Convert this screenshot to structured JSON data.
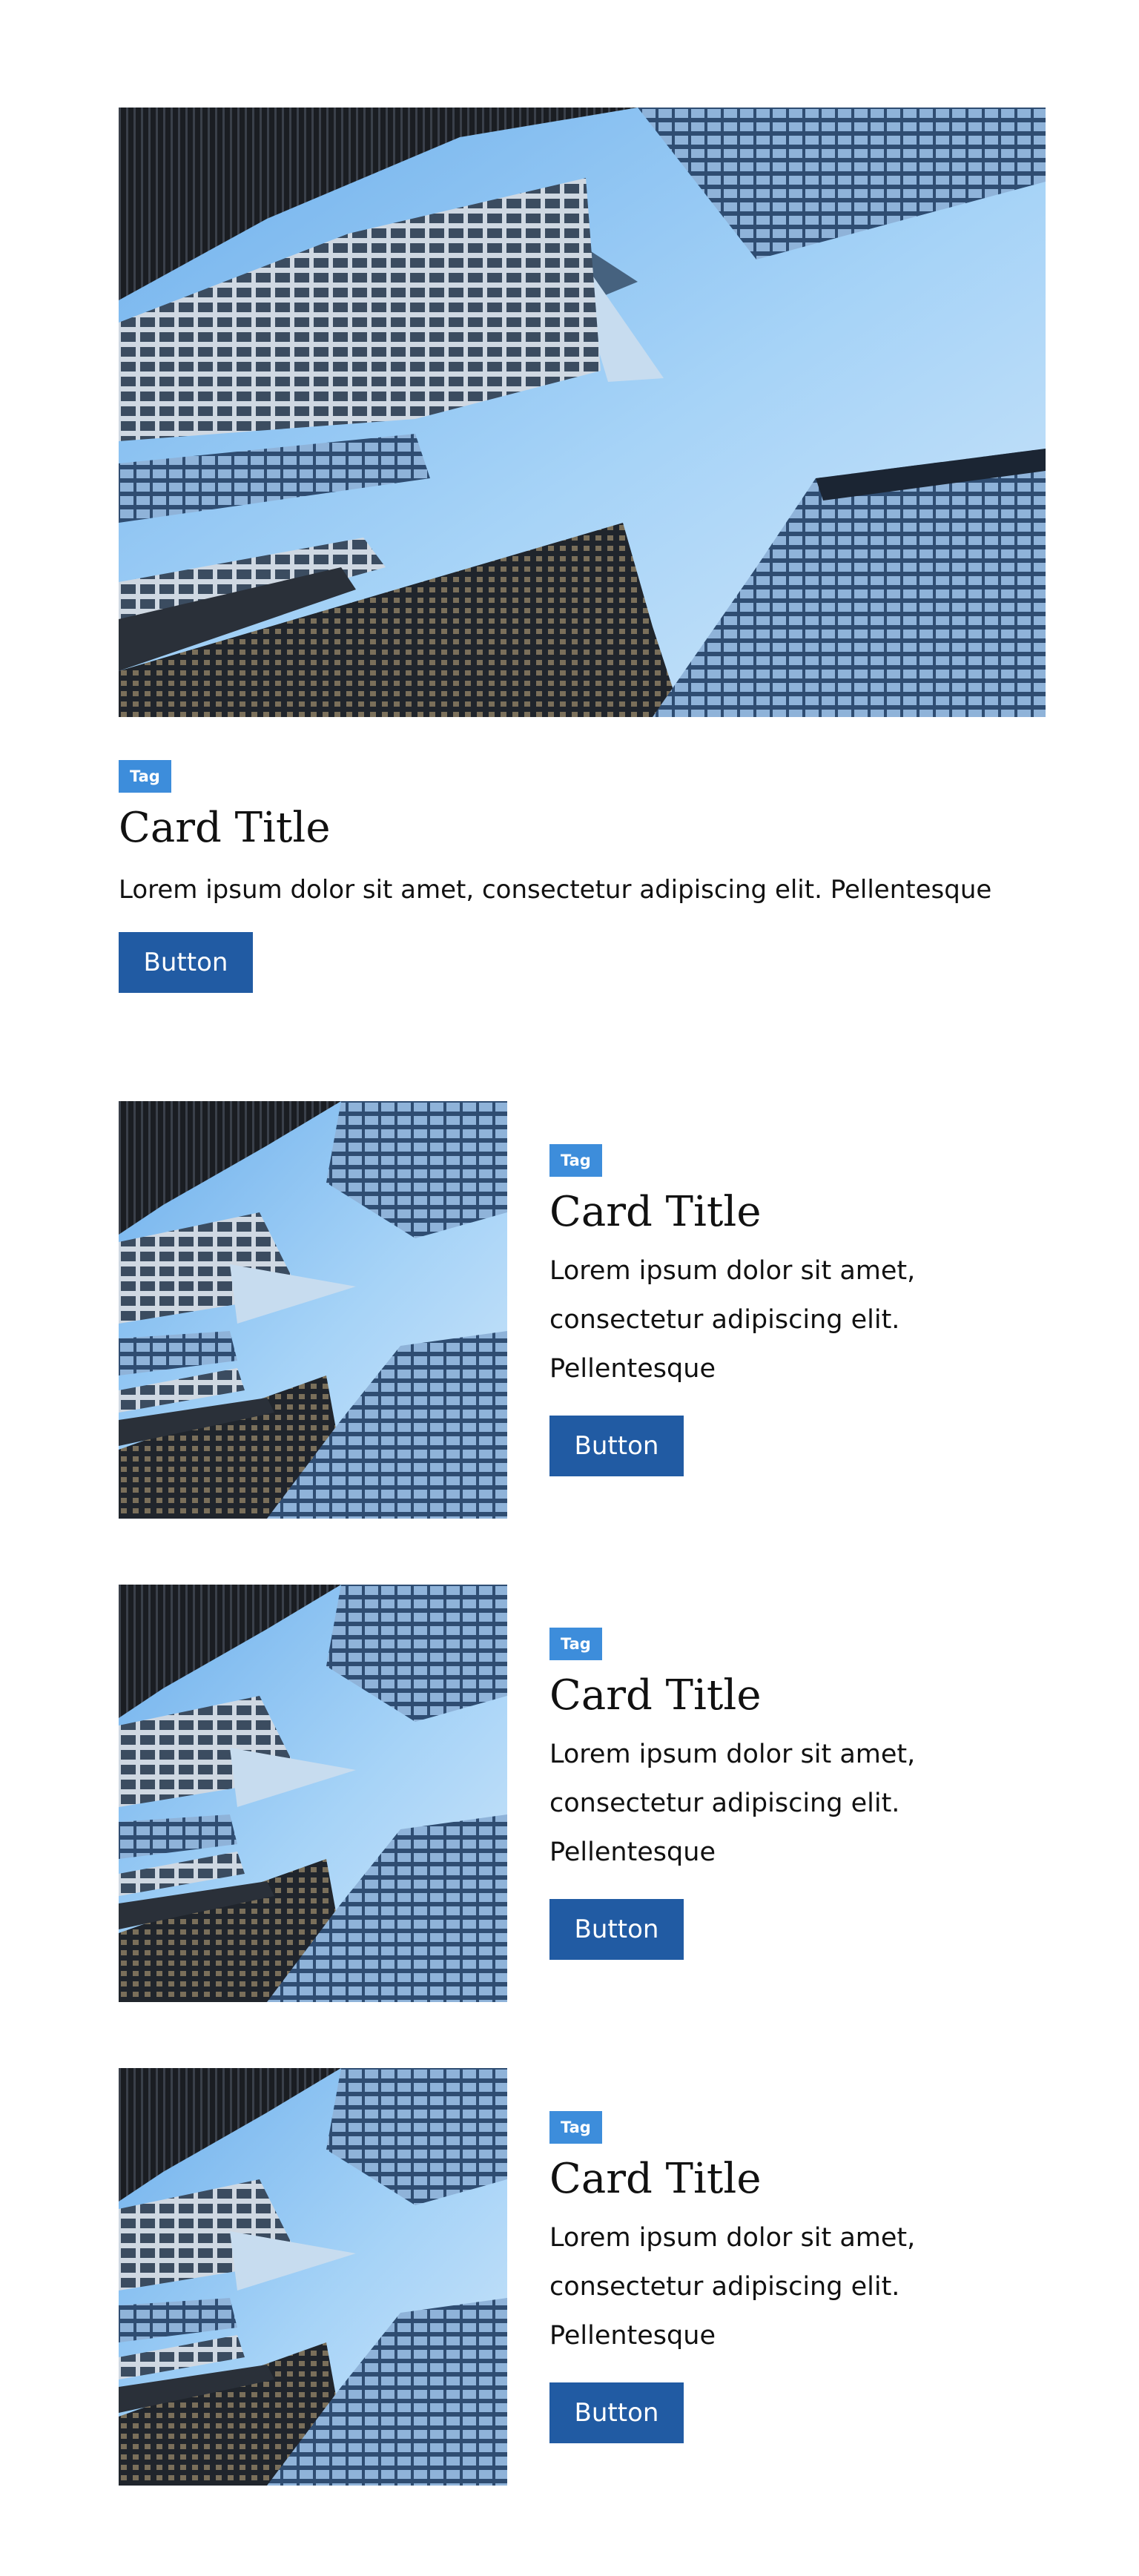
{
  "featured_card": {
    "image_alt": "Low-angle view of skyscrapers against a blue sky",
    "tag": "Tag",
    "title": "Card Title",
    "text": "Lorem ipsum dolor sit amet, consectetur adipiscing elit. Pellentesque",
    "button_label": "Button"
  },
  "cards": [
    {
      "tag": "Tag",
      "title": "Card Title",
      "text": "Lorem ipsum dolor sit amet, consectetur adipiscing elit. Pellentesque",
      "button_label": "Button"
    },
    {
      "tag": "Tag",
      "title": "Card Title",
      "text": "Lorem ipsum dolor sit amet, consectetur adipiscing elit. Pellentesque",
      "button_label": "Button"
    },
    {
      "tag": "Tag",
      "title": "Card Title",
      "text": "Lorem ipsum dolor sit amet, consectetur adipiscing elit. Pellentesque",
      "button_label": "Button"
    }
  ],
  "colors": {
    "tag_background": "#3d8ddb",
    "button_background": "#215ba3",
    "sky": "#8fc3f0",
    "building_dark": "#22262d",
    "building_glass": "#5a7ea8"
  }
}
